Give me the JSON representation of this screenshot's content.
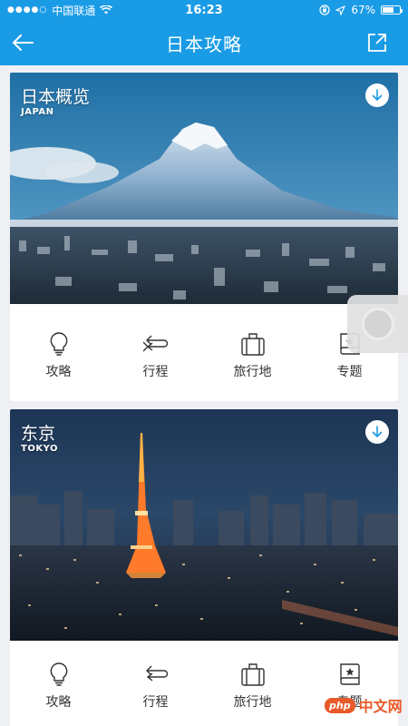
{
  "status_bar": {
    "carrier": "中国联通",
    "time": "16:23",
    "battery": "67%",
    "battery_level": 0.67
  },
  "nav": {
    "title": "日本攻略"
  },
  "cards": [
    {
      "name": "日本概览",
      "sub": "JAPAN",
      "actions": [
        {
          "label": "攻略",
          "icon": "lightbulb-icon"
        },
        {
          "label": "行程",
          "icon": "route-arrows-icon"
        },
        {
          "label": "旅行地",
          "icon": "suitcase-icon"
        },
        {
          "label": "专题",
          "icon": "star-book-icon"
        }
      ]
    },
    {
      "name": "东京",
      "sub": "TOKYO",
      "actions": [
        {
          "label": "攻略",
          "icon": "lightbulb-icon"
        },
        {
          "label": "行程",
          "icon": "route-arrows-icon"
        },
        {
          "label": "旅行地",
          "icon": "suitcase-icon"
        },
        {
          "label": "专题",
          "icon": "star-book-icon"
        }
      ]
    }
  ],
  "watermark": {
    "logo": "php",
    "text": "中文网"
  },
  "colors": {
    "accent": "#1a9be6",
    "background": "#eef0f3"
  }
}
